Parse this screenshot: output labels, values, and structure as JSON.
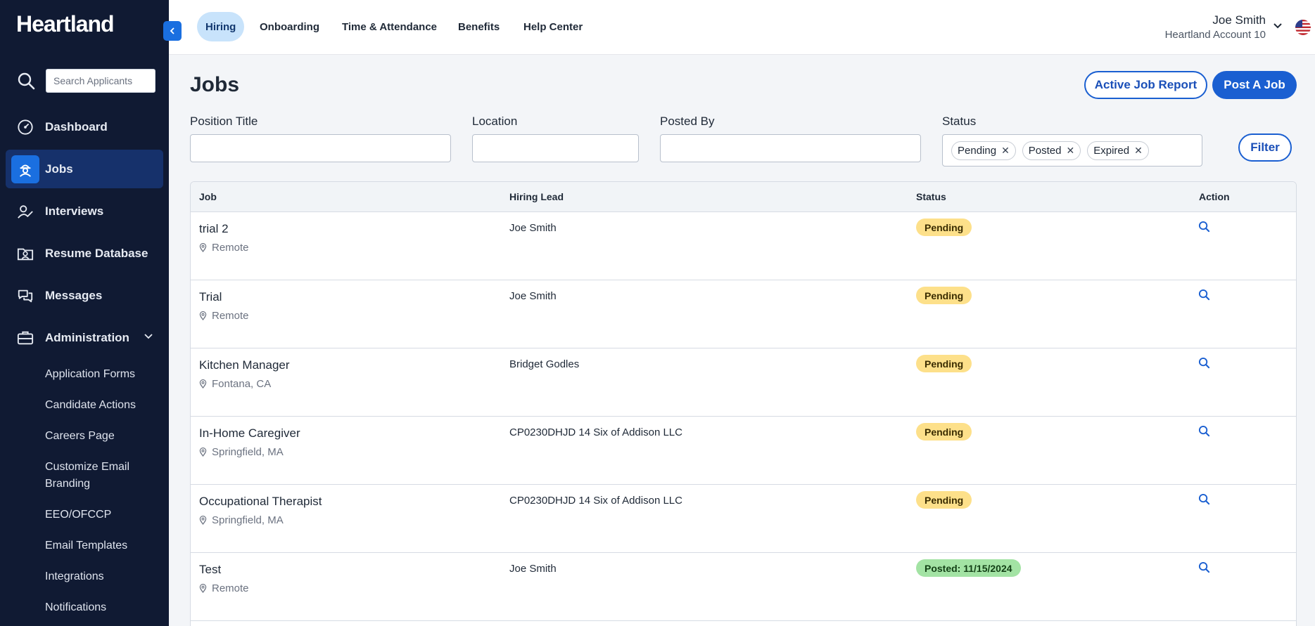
{
  "brand": {
    "logo": "Heartland"
  },
  "sidebar": {
    "search_placeholder": "Search Applicants",
    "items": [
      {
        "label": "Dashboard",
        "icon": "dashboard-gauge-icon"
      },
      {
        "label": "Jobs",
        "icon": "jobs-worker-icon",
        "active": true
      },
      {
        "label": "Interviews",
        "icon": "interview-person-icon"
      },
      {
        "label": "Resume Database",
        "icon": "resume-folder-icon"
      },
      {
        "label": "Messages",
        "icon": "messages-chat-icon"
      },
      {
        "label": "Administration",
        "icon": "administration-briefcase-icon",
        "expanded": true
      }
    ],
    "sub_items": [
      "Application Forms",
      "Candidate Actions",
      "Careers Page",
      "Customize Email Branding",
      "EEO/OFCCP",
      "Email Templates",
      "Integrations",
      "Notifications"
    ]
  },
  "topnav": {
    "tabs": [
      "Hiring",
      "Onboarding",
      "Time & Attendance",
      "Benefits",
      "Help Center"
    ],
    "active_tab": "Hiring",
    "user_name": "Joe Smith",
    "account": "Heartland Account 10"
  },
  "page": {
    "title": "Jobs",
    "active_report_label": "Active Job Report",
    "post_job_label": "Post A Job"
  },
  "filters": {
    "position_title_label": "Position Title",
    "position_title_value": "",
    "location_label": "Location",
    "location_value": "",
    "posted_by_label": "Posted By",
    "posted_by_value": "",
    "status_label": "Status",
    "status_chips": [
      "Pending",
      "Posted",
      "Expired"
    ],
    "filter_button": "Filter"
  },
  "table": {
    "columns": [
      "Job",
      "Hiring Lead",
      "Status",
      "Action"
    ],
    "rows": [
      {
        "job": "trial 2",
        "location": "Remote",
        "lead": "Joe Smith",
        "status": "Pending",
        "status_type": "pending"
      },
      {
        "job": "Trial",
        "location": "Remote",
        "lead": "Joe Smith",
        "status": "Pending",
        "status_type": "pending"
      },
      {
        "job": "Kitchen Manager",
        "location": "Fontana, CA",
        "lead": "Bridget Godles",
        "status": "Pending",
        "status_type": "pending"
      },
      {
        "job": "In-Home Caregiver",
        "location": "Springfield, MA",
        "lead": "CP0230DHJD 14 Six of Addison LLC",
        "status": "Pending",
        "status_type": "pending"
      },
      {
        "job": "Occupational Therapist",
        "location": "Springfield, MA",
        "lead": "CP0230DHJD 14 Six of Addison LLC",
        "status": "Pending",
        "status_type": "pending"
      },
      {
        "job": "Test",
        "location": "Remote",
        "lead": "Joe Smith",
        "status": "Posted: 11/15/2024",
        "status_type": "posted"
      }
    ]
  },
  "colors": {
    "sidebar_bg": "#101a33",
    "accent": "#1a5fd1",
    "pending_badge": "#fde08a",
    "posted_badge": "#a3e3a4"
  }
}
